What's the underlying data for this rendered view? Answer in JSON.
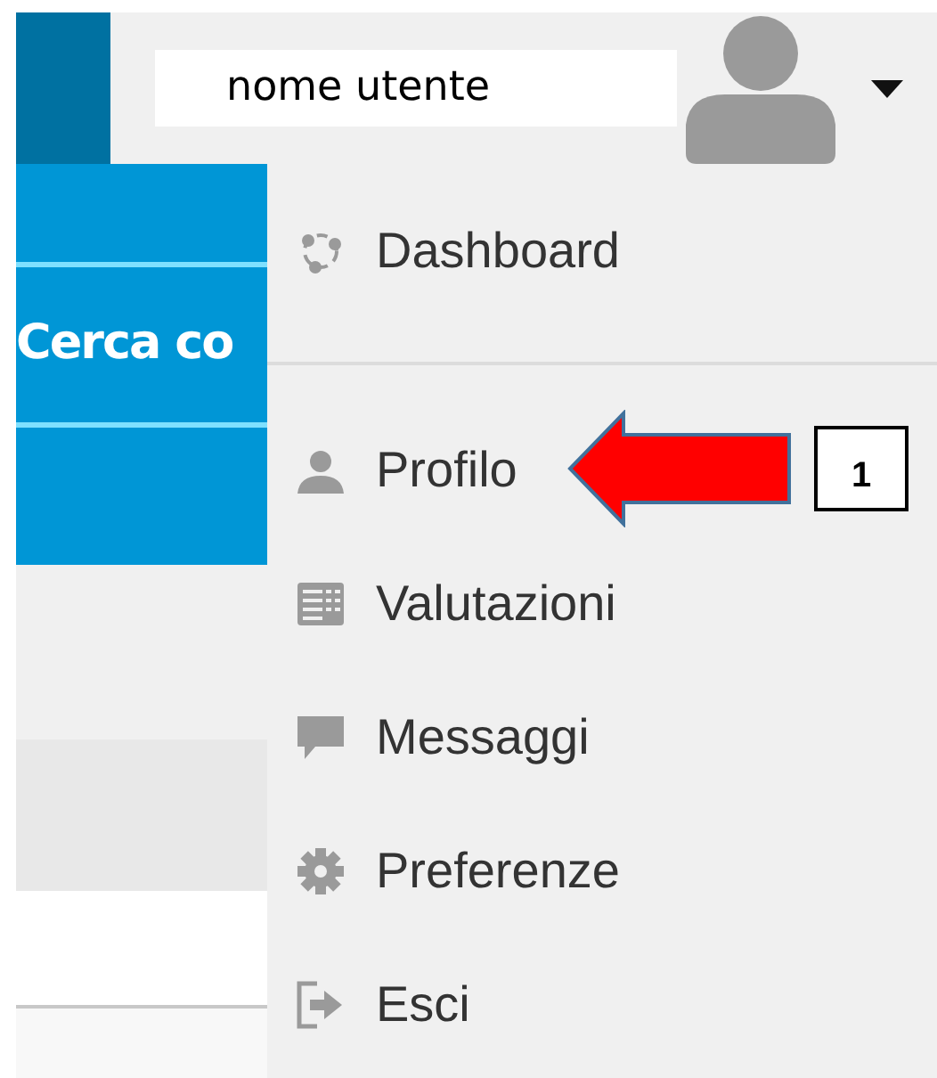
{
  "user_menu": {
    "username": "nome utente",
    "expanded": true
  },
  "side_nav": {
    "search_label": "Cerca co"
  },
  "menu": {
    "items": [
      {
        "label": "Dashboard",
        "kind": "dashboard",
        "divider_after": true
      },
      {
        "label": "Profilo",
        "kind": "profile",
        "divider_after": false
      },
      {
        "label": "Valutazioni",
        "kind": "grades",
        "divider_after": false
      },
      {
        "label": "Messaggi",
        "kind": "messages",
        "divider_after": false
      },
      {
        "label": "Preferenze",
        "kind": "settings",
        "divider_after": false
      },
      {
        "label": "Esci",
        "kind": "logout",
        "divider_after": false
      }
    ]
  },
  "annotation": {
    "number": "1"
  }
}
